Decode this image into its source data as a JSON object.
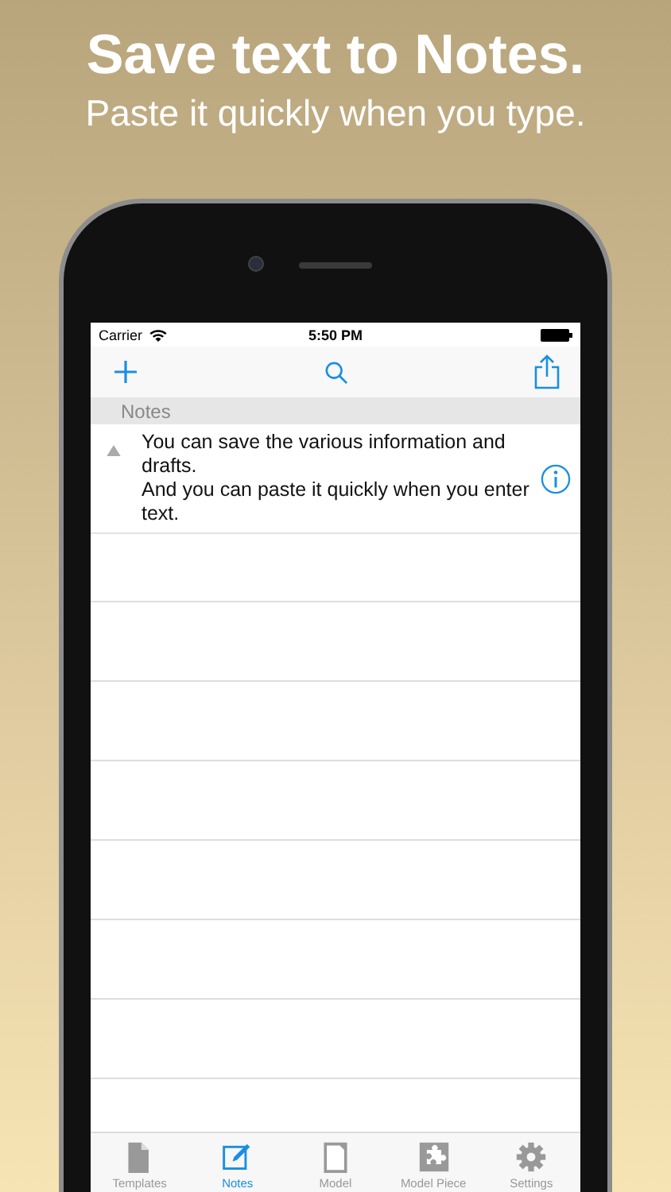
{
  "headline": {
    "title": "Save text to Notes.",
    "subtitle": "Paste it quickly when you type."
  },
  "status_bar": {
    "carrier": "Carrier",
    "time": "5:50 PM"
  },
  "section": {
    "title": "Notes"
  },
  "notes": [
    {
      "text": "You can save the various information and drafts.\nAnd you can paste it quickly when you enter text."
    }
  ],
  "tabs": [
    {
      "label": "Templates",
      "kind": "document",
      "selected": false
    },
    {
      "label": "Notes",
      "kind": "edit",
      "selected": true
    },
    {
      "label": "Model",
      "kind": "page",
      "selected": false
    },
    {
      "label": "Model Piece",
      "kind": "puzzle",
      "selected": false
    },
    {
      "label": "Settings",
      "kind": "gear",
      "selected": false
    }
  ]
}
